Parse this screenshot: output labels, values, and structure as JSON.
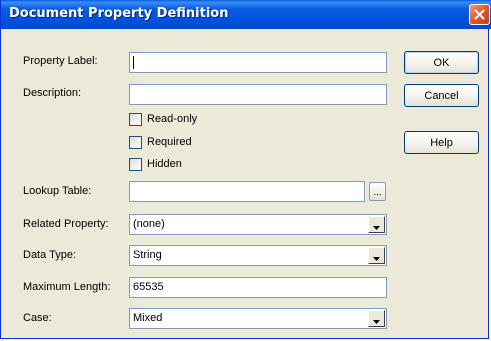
{
  "window": {
    "title": "Document Property Definition"
  },
  "fields": {
    "property_label": {
      "label": "Property Label:",
      "value": ""
    },
    "description": {
      "label": "Description:",
      "value": ""
    },
    "lookup_table": {
      "label": "Lookup Table:",
      "value": "",
      "browse_label": "..."
    },
    "related_property": {
      "label": "Related Property:",
      "value": "(none)"
    },
    "data_type": {
      "label": "Data Type:",
      "value": "String"
    },
    "maximum_length": {
      "label": "Maximum Length:",
      "value": "65535"
    },
    "case": {
      "label": "Case:",
      "value": "Mixed"
    }
  },
  "checkboxes": [
    {
      "label": "Read-only",
      "checked": false
    },
    {
      "label": "Required",
      "checked": false
    },
    {
      "label": "Hidden",
      "checked": false
    }
  ],
  "buttons": {
    "ok": "OK",
    "cancel": "Cancel",
    "help": "Help"
  },
  "icons": {
    "close": "close-icon",
    "dropdown": "chevron-down-icon"
  },
  "colors": {
    "titlebar": "#0054e3",
    "dialog_bg": "#ece9d8",
    "close_button": "#e0572c",
    "input_border": "#7f9db9"
  }
}
